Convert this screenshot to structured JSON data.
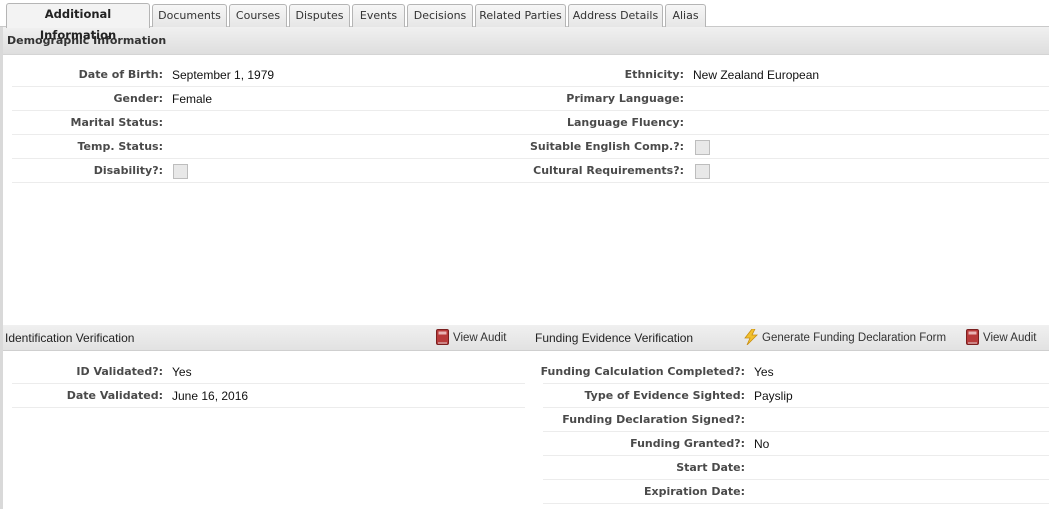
{
  "tabs": [
    {
      "label": "Additional Information",
      "active": true
    },
    {
      "label": "Documents",
      "active": false
    },
    {
      "label": "Courses",
      "active": false
    },
    {
      "label": "Disputes",
      "active": false
    },
    {
      "label": "Events",
      "active": false
    },
    {
      "label": "Decisions",
      "active": false
    },
    {
      "label": "Related Parties",
      "active": false
    },
    {
      "label": "Address Details",
      "active": false
    },
    {
      "label": "Alias",
      "active": false
    }
  ],
  "demographic": {
    "title": "Demographic Information",
    "left": [
      {
        "label": "Date of Birth:",
        "value": "September 1, 1979"
      },
      {
        "label": "Gender:",
        "value": "Female"
      },
      {
        "label": "Marital Status:",
        "value": ""
      },
      {
        "label": "Temp. Status:",
        "value": ""
      },
      {
        "label": "Disability?:",
        "checkbox": true,
        "checked": false
      }
    ],
    "right": [
      {
        "label": "Ethnicity:",
        "value": "New Zealand European"
      },
      {
        "label": "Primary Language:",
        "value": ""
      },
      {
        "label": "Language Fluency:",
        "value": ""
      },
      {
        "label": "Suitable English Comp.?:",
        "checkbox": true,
        "checked": false
      },
      {
        "label": "Cultural Requirements?:",
        "checkbox": true,
        "checked": false
      }
    ]
  },
  "identification": {
    "title": "Identification Verification",
    "view_audit": "View Audit",
    "rows": [
      {
        "label": "ID Validated?:",
        "value": "Yes"
      },
      {
        "label": "Date Validated:",
        "value": "June 16, 2016"
      }
    ]
  },
  "funding": {
    "title": "Funding Evidence Verification",
    "generate_label": "Generate Funding Declaration Form",
    "view_audit": "View Audit",
    "rows": [
      {
        "label": "Funding Calculation Completed?:",
        "value": "Yes"
      },
      {
        "label": "Type of Evidence Sighted:",
        "value": "Payslip"
      },
      {
        "label": "Funding Declaration Signed?:",
        "value": ""
      },
      {
        "label": "Funding Granted?:",
        "value": "No"
      },
      {
        "label": "Start Date:",
        "value": ""
      },
      {
        "label": "Expiration Date:",
        "value": ""
      }
    ]
  },
  "colors": {
    "audit_icon": "#b83a3a",
    "bolt_icon": "#f2c12e"
  }
}
